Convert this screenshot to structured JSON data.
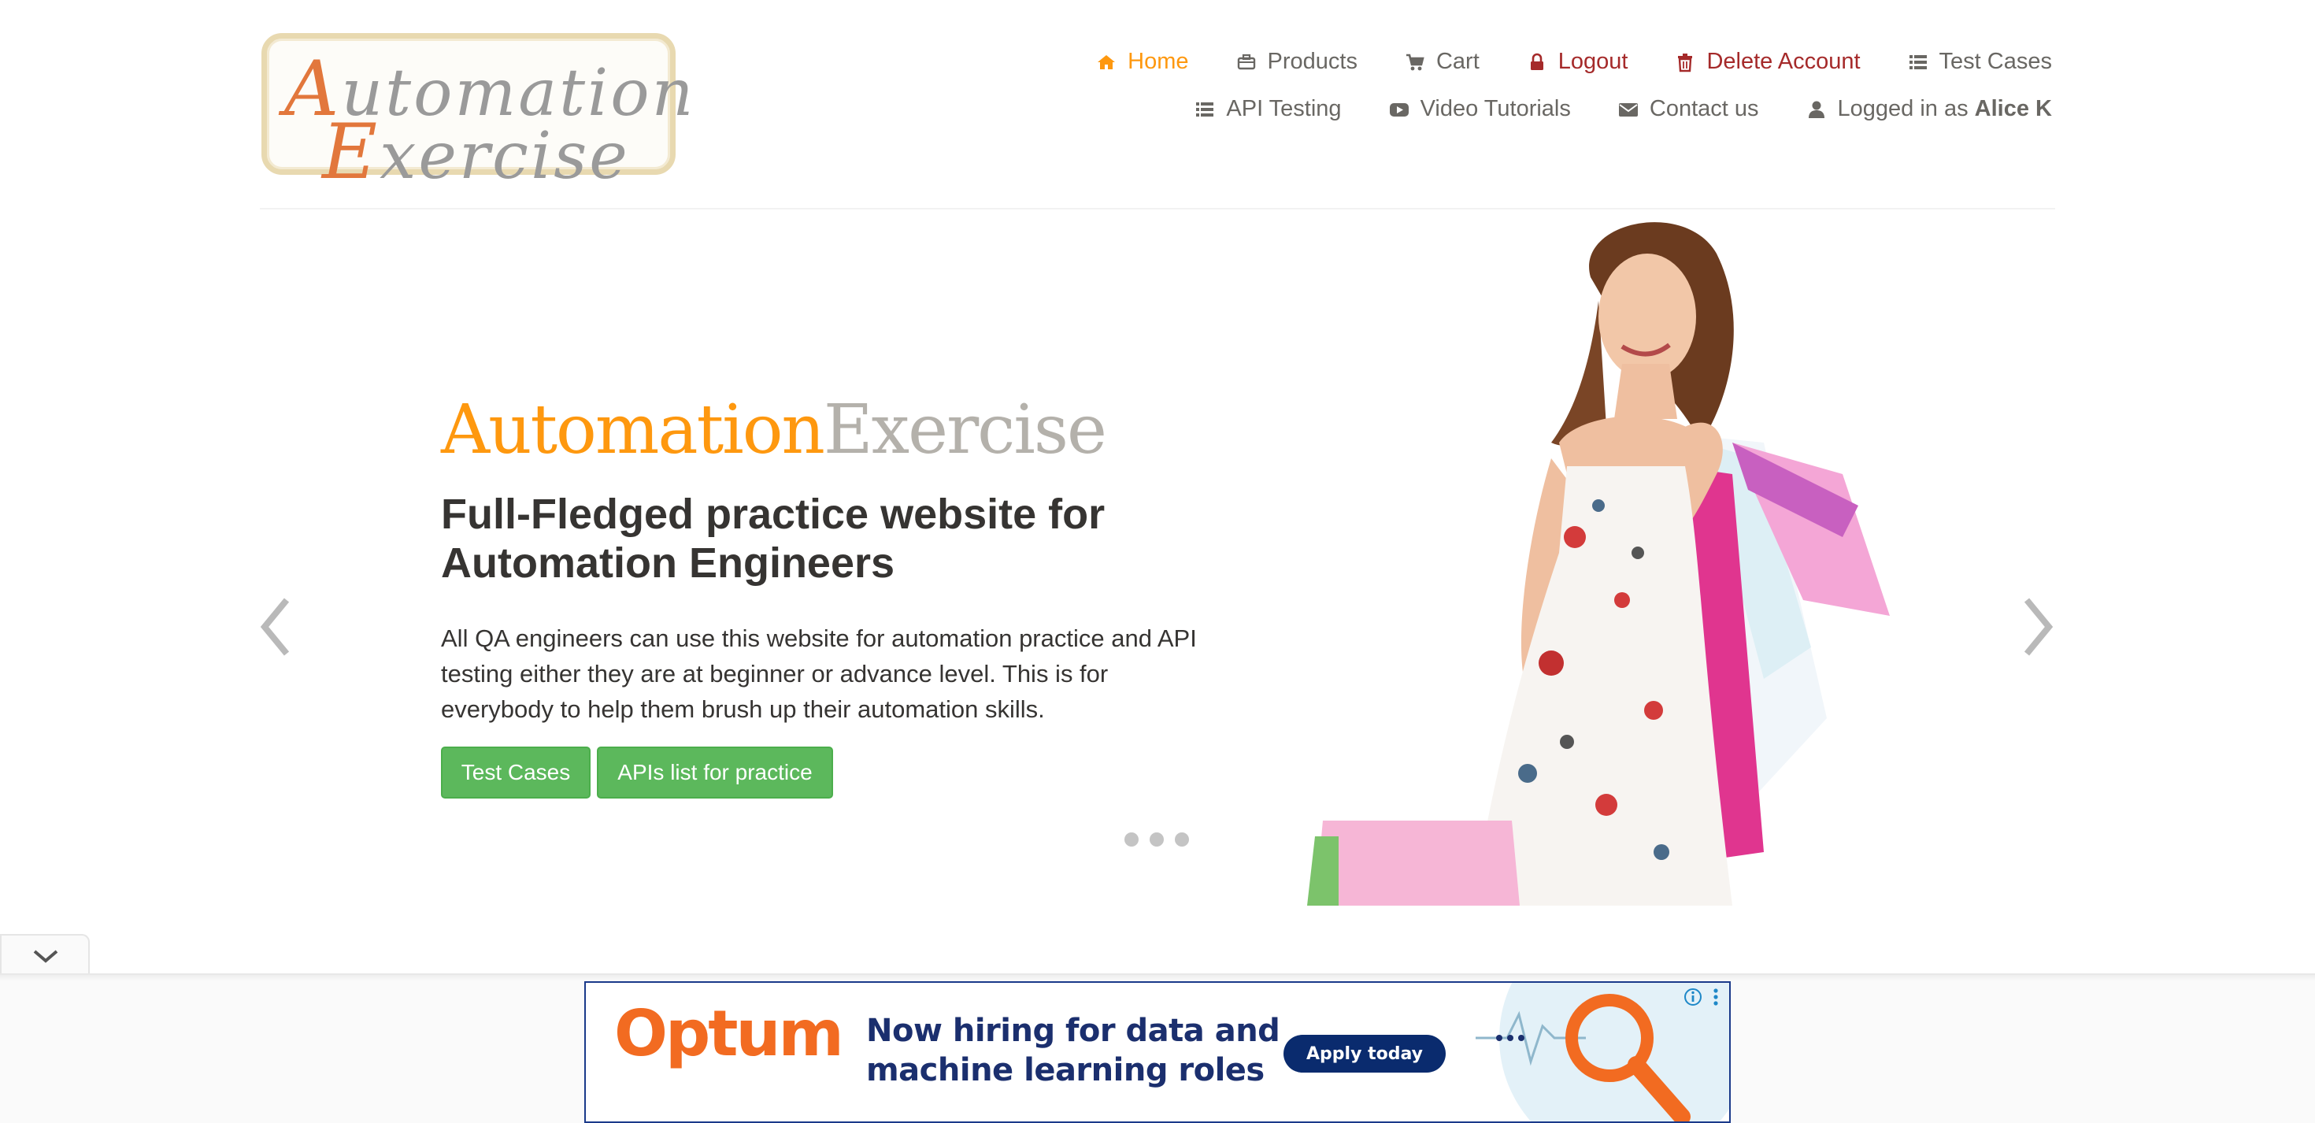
{
  "logo": {
    "line1_cap": "A",
    "line1_rest": "utomation",
    "line2_cap": "E",
    "line2_rest": "xercise"
  },
  "nav": {
    "row1": [
      {
        "label": "Home",
        "icon": "home-icon",
        "state": "active"
      },
      {
        "label": "Products",
        "icon": "briefcase-icon"
      },
      {
        "label": "Cart",
        "icon": "shopping-cart-icon"
      },
      {
        "label": "Logout",
        "icon": "lock-icon"
      },
      {
        "label": "Delete Account",
        "icon": "trash-icon"
      },
      {
        "label": "Test Cases",
        "icon": "list-icon"
      }
    ],
    "row2": [
      {
        "label": "API Testing",
        "icon": "list-icon"
      },
      {
        "label": "Video Tutorials",
        "icon": "youtube-play-icon"
      },
      {
        "label": "Contact us",
        "icon": "envelope-icon"
      },
      {
        "label": "Logged in as",
        "icon": "user-icon"
      }
    ],
    "logged_in_user": "Alice K"
  },
  "slider": {
    "brand_part1": "Automation",
    "brand_part2": "Exercise",
    "headline_line1": "Full-Fledged practice website for",
    "headline_line2": "Automation Engineers",
    "description": "All QA engineers can use this website for automation practice and API testing either they are at beginner or advance level. This is for everybody to help them brush up their automation skills.",
    "button_test_cases": "Test Cases",
    "button_apis": "APIs list for practice",
    "prev_icon": "chevron-left-icon",
    "next_icon": "chevron-right-icon",
    "slide_count": 3
  },
  "ad": {
    "brand": "Optum",
    "copy_line1": "Now hiring for data and",
    "copy_line2": "machine learning roles",
    "cta": "Apply today"
  },
  "colors": {
    "accent_orange": "#fe980f",
    "link_red": "#a52a2a",
    "button_green": "#5cb85c",
    "text_dark": "#363432",
    "text_gray": "#696763",
    "ad_orange": "#f26b21",
    "ad_navy": "#0a2b6e"
  }
}
